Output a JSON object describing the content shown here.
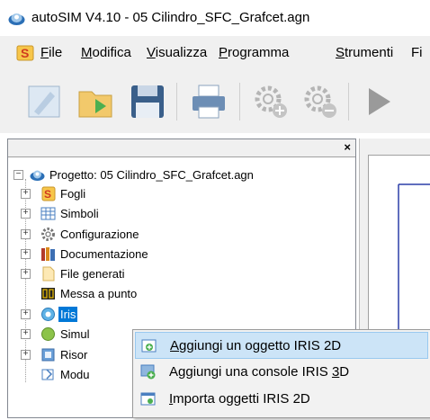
{
  "window": {
    "title": "autoSIM  V4.10 - 05 Cilindro_SFC_Grafcet.agn"
  },
  "menubar": {
    "items": [
      {
        "hot": "F",
        "rest": "ile"
      },
      {
        "hot": "M",
        "rest": "odifica"
      },
      {
        "hot": "V",
        "rest": "isualizza"
      },
      {
        "hot": "P",
        "rest": "rogramma"
      },
      {
        "hot": "S",
        "rest": "trumenti"
      },
      {
        "hot": "",
        "rest": "Fi"
      }
    ]
  },
  "toolbar": {
    "buttons": [
      "edit-icon",
      "open-folder-icon",
      "save-icon",
      "print-icon",
      "gear-add-icon",
      "gear-remove-icon",
      "play-icon"
    ]
  },
  "panel": {
    "close_label": "×"
  },
  "tree": {
    "root": "Progetto: 05 Cilindro_SFC_Grafcet.agn",
    "items": [
      {
        "label": "Fogli",
        "icon": "sheets-icon"
      },
      {
        "label": "Simboli",
        "icon": "table-icon"
      },
      {
        "label": "Configurazione",
        "icon": "gear-icon"
      },
      {
        "label": "Documentazione",
        "icon": "books-icon"
      },
      {
        "label": "File generati",
        "icon": "file-icon"
      },
      {
        "label": "Messa a punto",
        "icon": "debug-icon"
      },
      {
        "label": "Iris",
        "icon": "iris-icon"
      },
      {
        "label": "Simul",
        "icon": "simulation-icon"
      },
      {
        "label": "Risor",
        "icon": "resources-icon"
      },
      {
        "label": "Modu",
        "icon": "module-icon"
      }
    ]
  },
  "context_menu": {
    "items": [
      {
        "hot": "A",
        "rest": "ggiungi un oggetto IRIS 2D",
        "highlighted": true
      },
      {
        "pre": "Aggiungi una console IRIS ",
        "hot": "3",
        "rest": "D",
        "highlighted": false
      },
      {
        "hot": "I",
        "rest": "mporta oggetti IRIS 2D",
        "highlighted": false
      }
    ]
  }
}
